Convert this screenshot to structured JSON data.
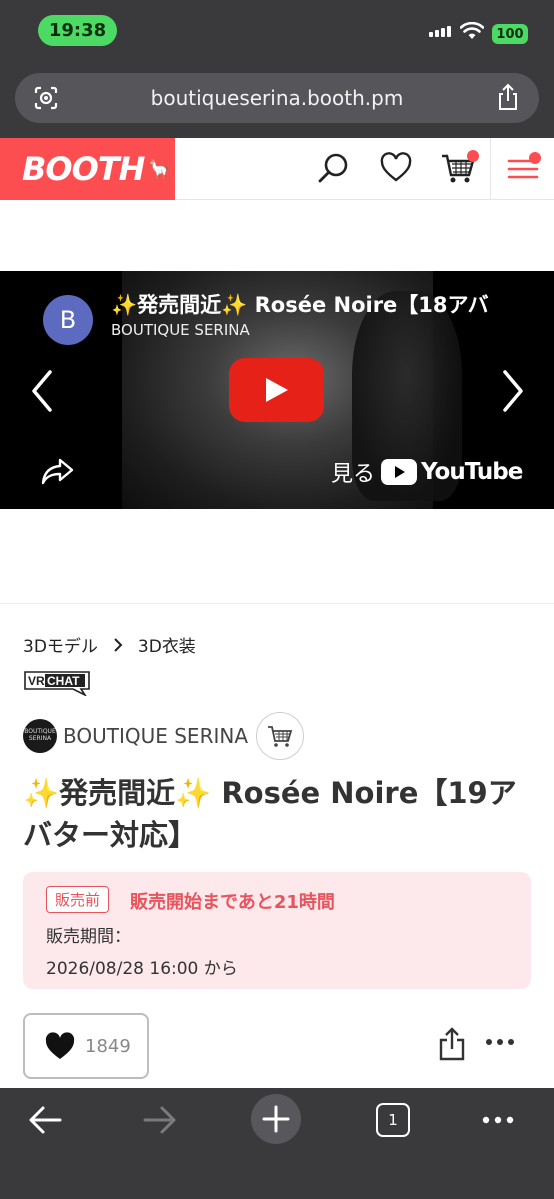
{
  "status_bar": {
    "time": "19:38",
    "battery": "100"
  },
  "browser": {
    "url": "boutiqueserina.booth.pm",
    "tab_count": "1"
  },
  "booth": {
    "logo_text": "BOOTH",
    "accent_color": "#fc4d50",
    "cart_has_badge": true,
    "menu_has_badge": true
  },
  "video": {
    "channel_initial": "B",
    "title": "✨発売間近✨ Rosée Noire【18アバ",
    "channel_name": "BOUTIQUE SERINA",
    "watch_on_label": "見る",
    "youtube_label": "YouTube",
    "play_button_color": "#e62117"
  },
  "breadcrumb": {
    "category": "3Dモデル",
    "subcategory": "3D衣装"
  },
  "vrchat_badge": "VRCHAT",
  "shop": {
    "avatar_text": "BOUTIQUE SERINA",
    "name": "BOUTIQUE SERINA"
  },
  "product": {
    "title": "✨発売間近✨ Rosée Noire【19アバター対応】",
    "presale_tag": "販売前",
    "countdown": "販売開始まであと21時間",
    "period_label": "販売期間：",
    "period_value": "2026/08/28 16:00 から",
    "like_count": "1849"
  },
  "icons": {
    "lens": "camera-lens-icon",
    "share_top": "share-icon",
    "search": "search-icon",
    "heart": "heart-icon",
    "cart": "cart-icon",
    "menu": "hamburger-menu-icon",
    "prev": "chevron-left-icon",
    "next": "chevron-right-icon",
    "video_share": "forward-arrow-icon",
    "back": "back-arrow-icon",
    "forward": "forward-arrow-icon",
    "new_tab": "plus-icon",
    "more": "ellipsis-icon"
  }
}
